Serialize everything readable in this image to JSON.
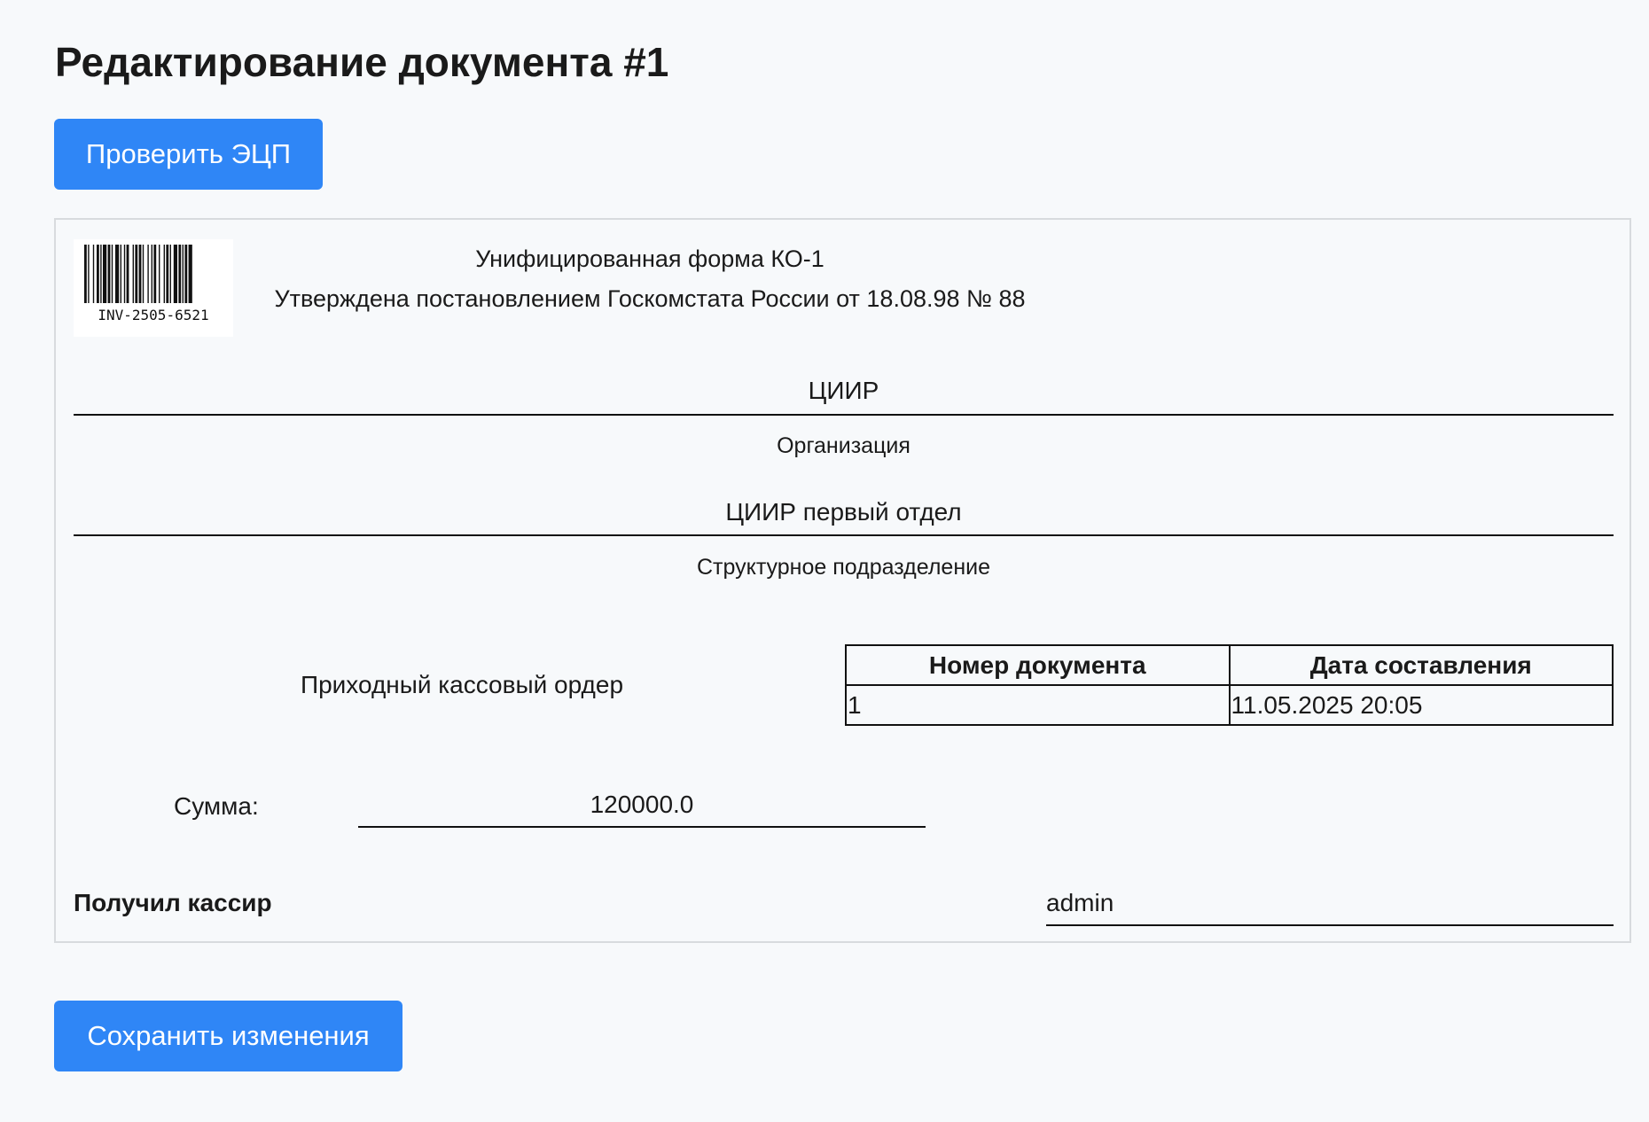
{
  "page": {
    "title": "Редактирование документа #1"
  },
  "toolbar": {
    "verify_label": "Проверить ЭЦП",
    "save_label": "Сохранить изменения"
  },
  "document": {
    "barcode_text": "INV-2505-6521",
    "form_name": "Унифицированная форма КО-1",
    "form_approval": "Утверждена постановлением Госкомстата России от 18.08.98 № 88",
    "organization": {
      "value": "ЦИИР",
      "label": "Организация"
    },
    "department": {
      "value": "ЦИИР первый отдел",
      "label": "Структурное подразделение"
    },
    "order_title": "Приходный кассовый ордер",
    "table": {
      "headers": [
        "Номер документа",
        "Дата составления"
      ],
      "row": [
        "1",
        "11.05.2025 20:05"
      ]
    },
    "sum": {
      "label": "Сумма:",
      "value": "120000.0"
    },
    "cashier": {
      "label": "Получил кассир",
      "value": "admin"
    }
  }
}
